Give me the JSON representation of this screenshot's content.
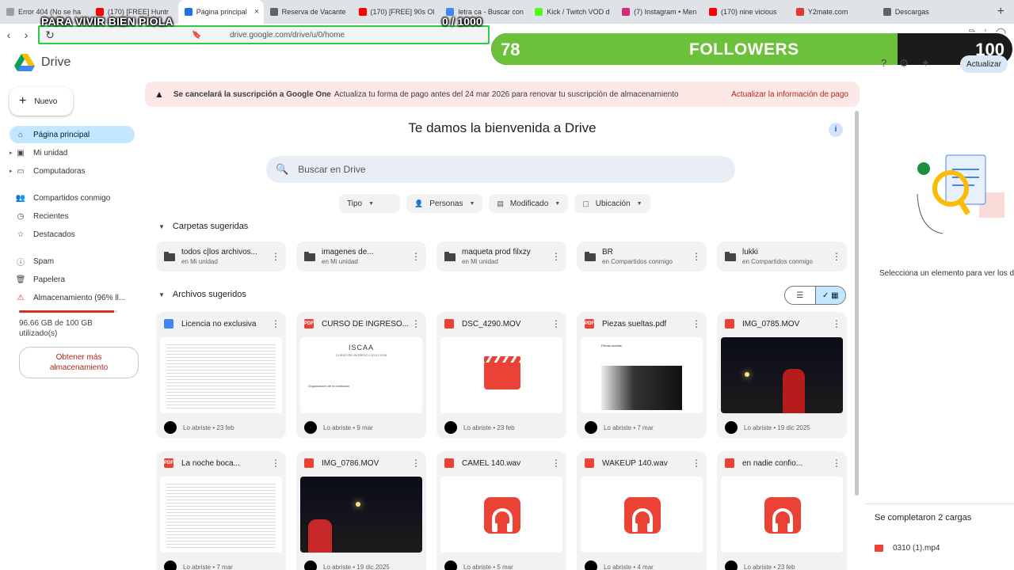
{
  "browser": {
    "tabs": [
      {
        "label": "Error 404 (No se ha",
        "color": "#9aa0a6"
      },
      {
        "label": "(170) [FREE] Huntr",
        "color": "#ff0000"
      },
      {
        "label": "Página principal",
        "color": "#1a73e8",
        "active": true
      },
      {
        "label": "Reserva de Vacante",
        "color": "#5f6368"
      },
      {
        "label": "(170) [FREE] 90s Ol",
        "color": "#ff0000"
      },
      {
        "label": "letra ca - Buscar con",
        "color": "#4285f4"
      },
      {
        "label": "Kick / Twitch VOD d",
        "color": "#53fc18"
      },
      {
        "label": "(7) Instagram • Men",
        "color": "#d62976"
      },
      {
        "label": "(170) nine vicious",
        "color": "#ff0000"
      },
      {
        "label": "Y2mate.com",
        "color": "#e53935"
      },
      {
        "label": "Descargas",
        "color": "#5f6368"
      }
    ],
    "url": "drive.google.com/drive/u/0/home"
  },
  "overlay": {
    "title": "PARA VIVIR BIEN PIOLA",
    "counter": "0   / 1000",
    "followers_current": "78",
    "followers_label": "FOLLOWERS",
    "followers_goal": "100",
    "progress_fraction": 0.78,
    "bar_color": "#6cc13a"
  },
  "drive": {
    "logo_text": "Drive",
    "update_label": "Actualizar",
    "new_label": "Nuevo",
    "sidebar": [
      {
        "label": "Página principal",
        "icon": "home-icon",
        "active": true
      },
      {
        "label": "Mi unidad",
        "icon": "my-drive-icon",
        "caret": true
      },
      {
        "label": "Computadoras",
        "icon": "computer-icon",
        "caret": true
      },
      {
        "label": "Compartidos conmigo",
        "icon": "shared-icon"
      },
      {
        "label": "Recientes",
        "icon": "clock-icon"
      },
      {
        "label": "Destacados",
        "icon": "star-icon"
      },
      {
        "label": "Spam",
        "icon": "spam-icon"
      },
      {
        "label": "Papelera",
        "icon": "trash-icon"
      },
      {
        "label": "Almacenamiento (96% ll...",
        "icon": "warning-icon"
      }
    ],
    "storage": {
      "used_text": "96.66 GB de 100 GB utilizado(s)",
      "fraction": 0.9666,
      "button": "Obtener más almacenamiento"
    },
    "banner": {
      "bold": "Se cancelará la suscripción a Google One",
      "text": "Actualiza tu forma de pago antes del 24 mar 2026 para renovar tu suscripción de almacenamiento",
      "action": "Actualizar la información de pago"
    },
    "welcome": "Te damos la bienvenida a Drive",
    "search_placeholder": "Buscar en Drive",
    "filters": [
      "Tipo",
      "Personas",
      "Modificado",
      "Ubicación"
    ],
    "folders_title": "Carpetas sugeridas",
    "folders": [
      {
        "name": "todos c|los archivos...",
        "location": "en Mi unidad"
      },
      {
        "name": "imagenes de...",
        "location": "en Mi unidad"
      },
      {
        "name": "maqueta prod filxzy",
        "location": "en Mi unidad"
      },
      {
        "name": "BR",
        "location": "en Compartidos conmigo"
      },
      {
        "name": "lukki",
        "location": "en Compartidos conmigo"
      }
    ],
    "files_title": "Archivos sugeridos",
    "files": [
      {
        "name": "Licencia no exclusiva",
        "type": "doc",
        "meta": "Lo abriste • 23 feb",
        "thumb": "doc"
      },
      {
        "name": "CURSO DE INGRESO...",
        "type": "pdf",
        "meta": "Lo abriste • 9 mar",
        "thumb": "iscaa"
      },
      {
        "name": "DSC_4290.MOV",
        "type": "video",
        "meta": "Lo abriste • 23 feb",
        "thumb": "video"
      },
      {
        "name": "Piezas sueltas.pdf",
        "type": "pdf",
        "meta": "Lo abriste • 7 mar",
        "thumb": "photo-doc"
      },
      {
        "name": "IMG_0785.MOV",
        "type": "video",
        "meta": "Lo abriste • 19 dic 2025",
        "thumb": "night"
      },
      {
        "name": "La noche boca...",
        "type": "pdf",
        "meta": "Lo abriste • 7 mar",
        "thumb": "doc"
      },
      {
        "name": "IMG_0786.MOV",
        "type": "video",
        "meta": "Lo abriste • 19 dic 2025",
        "thumb": "night2"
      },
      {
        "name": "CAMEL 140.wav",
        "type": "audio",
        "meta": "Lo abriste • 5 mar",
        "thumb": "audio"
      },
      {
        "name": "WAKEUP 140.wav",
        "type": "audio",
        "meta": "Lo abriste • 4 mar",
        "thumb": "audio"
      },
      {
        "name": "en nadie confio...",
        "type": "audio",
        "meta": "Lo abriste • 23 feb",
        "thumb": "audio"
      }
    ],
    "iscaa": {
      "title": "ISCAA",
      "subtitle": "CURSO DE INGRESO CICLO 2026",
      "small": "Organización de la institución"
    },
    "piezas_heading": "Piezas sueltas",
    "details_hint": "Selecciona un elemento para ver los d",
    "uploads": {
      "title": "Se completaron 2 cargas",
      "file": "0310 (1).mp4"
    }
  },
  "colors": {
    "active_nav": "#c2e7ff",
    "danger": "#b3261e",
    "drive_red": "#ea4335",
    "doc_blue": "#4285f4"
  }
}
